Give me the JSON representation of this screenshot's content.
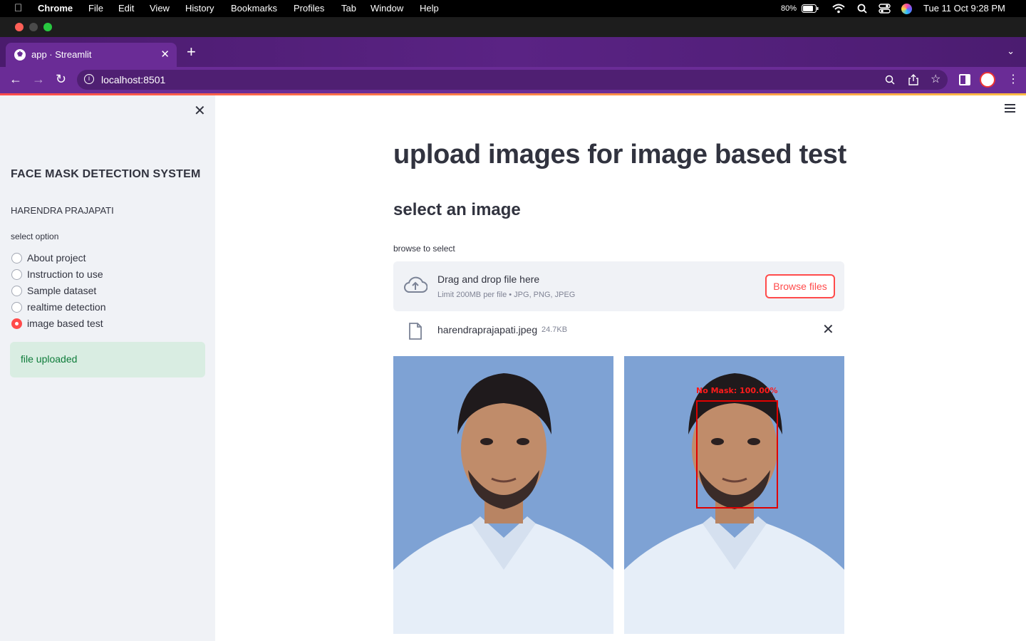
{
  "menubar": {
    "app": "Chrome",
    "items": [
      "File",
      "Edit",
      "View",
      "History",
      "Bookmarks",
      "Profiles",
      "Tab",
      "Window",
      "Help"
    ],
    "battery": "80%",
    "datetime": "Tue 11 Oct  9:28 PM"
  },
  "browser": {
    "tab_title": "app · Streamlit",
    "url": "localhost:8501"
  },
  "sidebar": {
    "title": "FACE MASK DETECTION SYSTEM",
    "author": "HARENDRA PRAJAPATI",
    "select_label": "select option",
    "options": [
      "About project",
      "Instruction to use",
      "Sample dataset",
      "realtime detection",
      "image based test"
    ],
    "selected": "image based test",
    "status": "file uploaded"
  },
  "main": {
    "title": "upload images for image based test",
    "subtitle": "select an image",
    "uploader_label": "browse to select",
    "dropzone_text": "Drag and drop file here",
    "dropzone_limit": "Limit 200MB per file • JPG, PNG, JPEG",
    "browse_label": "Browse files",
    "file_name": "harendraprajapati.jpeg",
    "file_size": "24.7KB",
    "detection_label": "No Mask: 100.00%"
  },
  "colors": {
    "accent": "#ff4b4b",
    "sidebar_bg": "#f0f2f6",
    "success_bg": "#d9ede2",
    "success_text": "#0e7c3a",
    "browser_purple": "#6a2c96"
  }
}
